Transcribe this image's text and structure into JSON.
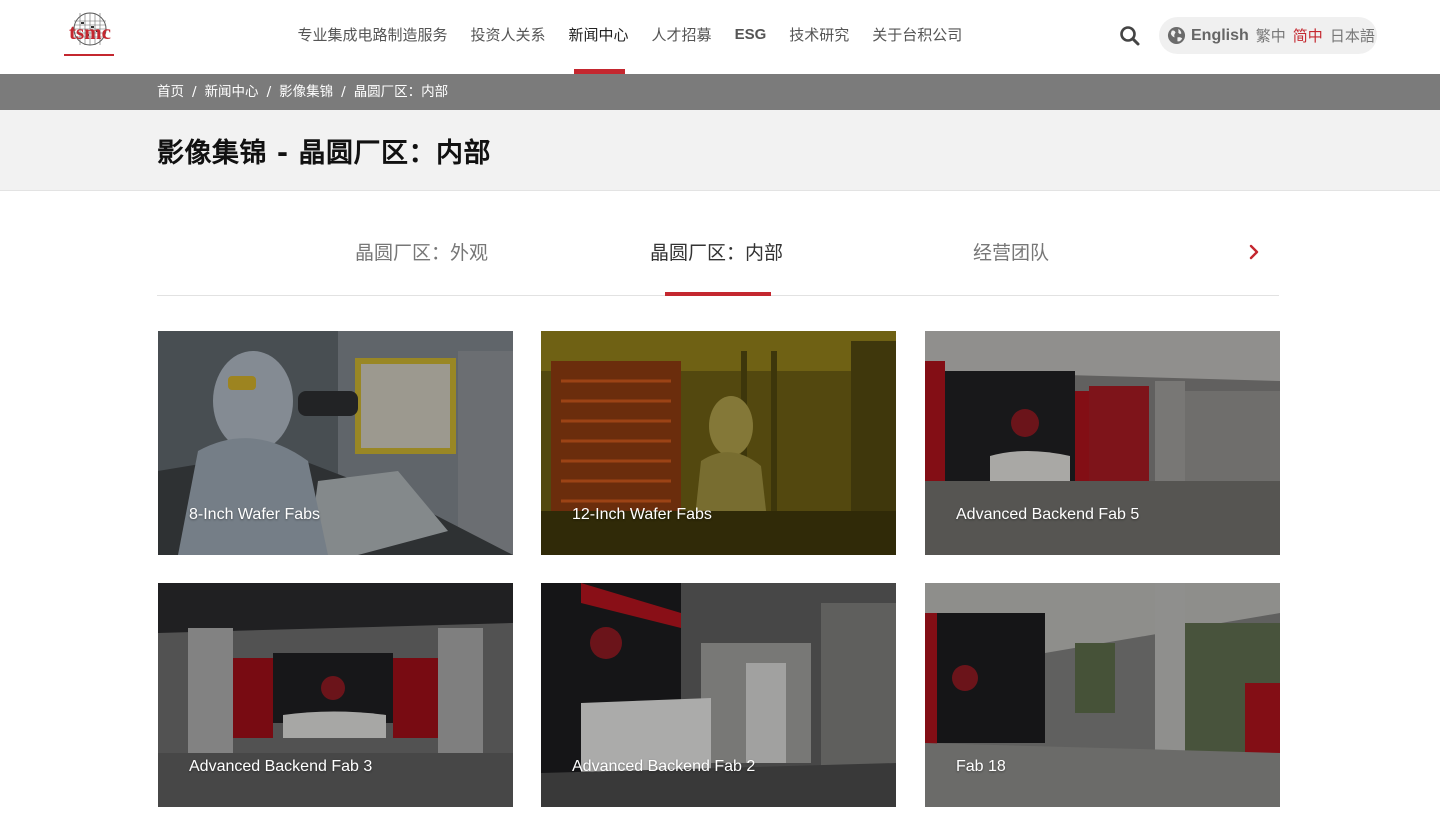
{
  "header": {
    "logo_text": "tsmc",
    "nav": [
      {
        "label": "专业集成电路制造服务"
      },
      {
        "label": "投资人关系"
      },
      {
        "label": "新闻中心",
        "active": true
      },
      {
        "label": "人才招募"
      },
      {
        "label": "ESG"
      },
      {
        "label": "技术研究"
      },
      {
        "label": "关于台积公司"
      }
    ],
    "languages": [
      {
        "label": "English"
      },
      {
        "label": "繁中"
      },
      {
        "label": "简中",
        "active": true
      },
      {
        "label": "日本語"
      }
    ],
    "icons": {
      "search": "search-icon",
      "globe": "globe-icon"
    },
    "accent_color": "#c4272f"
  },
  "breadcrumb": {
    "items": [
      "首页",
      "新闻中心",
      "影像集锦",
      "晶圆厂区：内部"
    ],
    "separator": "/"
  },
  "page": {
    "title": "影像集锦 - 晶圆厂区：内部"
  },
  "tabs": {
    "items": [
      {
        "label": "晶圆厂区：外观"
      },
      {
        "label": "晶圆厂区：内部",
        "active": true
      },
      {
        "label": "经营团队"
      }
    ],
    "next_icon": "chevron-right-icon"
  },
  "gallery": {
    "items": [
      {
        "label": "8-Inch Wafer Fabs"
      },
      {
        "label": "12-Inch Wafer Fabs"
      },
      {
        "label": "Advanced Backend Fab 5"
      },
      {
        "label": "Advanced Backend Fab 3"
      },
      {
        "label": "Advanced Backend Fab 2"
      },
      {
        "label": "Fab 18"
      }
    ]
  }
}
